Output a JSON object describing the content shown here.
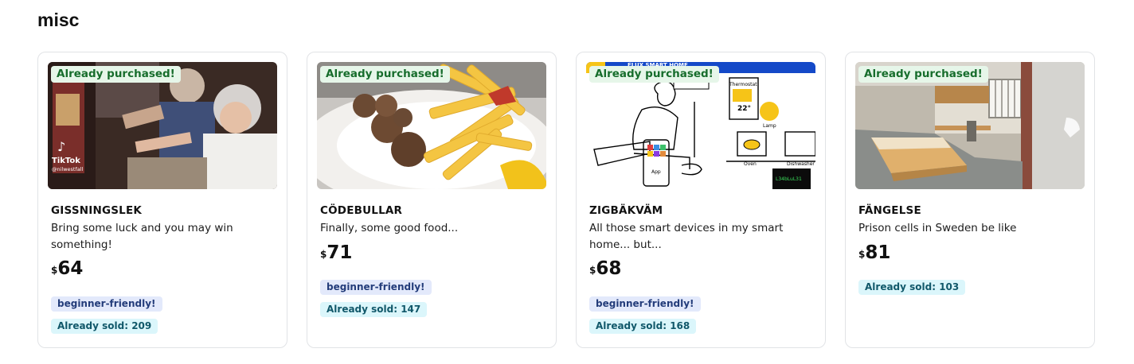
{
  "section": {
    "title": "misc"
  },
  "items": [
    {
      "name": "GISSNINGSLEK",
      "description": "Bring some luck and you may win something!",
      "currency": "$",
      "price": "64",
      "purchased_label": "Already purchased!",
      "tag": "beginner-friendly!",
      "sold_label": "Already sold: 209",
      "image_caption": "TikTok",
      "image_handle": "@nilwestfall"
    },
    {
      "name": "CÖDEBULLAR",
      "description": "Finally, some good food...",
      "currency": "$",
      "price": "71",
      "purchased_label": "Already purchased!",
      "tag": "beginner-friendly!",
      "sold_label": "Already sold: 147"
    },
    {
      "name": "ZIGBÄKVÄM",
      "description": "All those smart devices in my smart home... but...",
      "currency": "$",
      "price": "68",
      "purchased_label": "Already purchased!",
      "tag": "beginner-friendly!",
      "sold_label": "Already sold: 168",
      "image_banner": "FLUX SMART HOME",
      "image_labels": {
        "thermostat": "Thermostat",
        "temperature": "22°",
        "lamp": "Lamp",
        "oven": "Oven",
        "dishwasher": "Dishwasher",
        "app": "App",
        "screen": "L34bLuL31"
      }
    },
    {
      "name": "FÄNGELSE",
      "description": "Prison cells in Sweden be like",
      "currency": "$",
      "price": "81",
      "purchased_label": "Already purchased!",
      "sold_label": "Already sold: 103"
    }
  ]
}
